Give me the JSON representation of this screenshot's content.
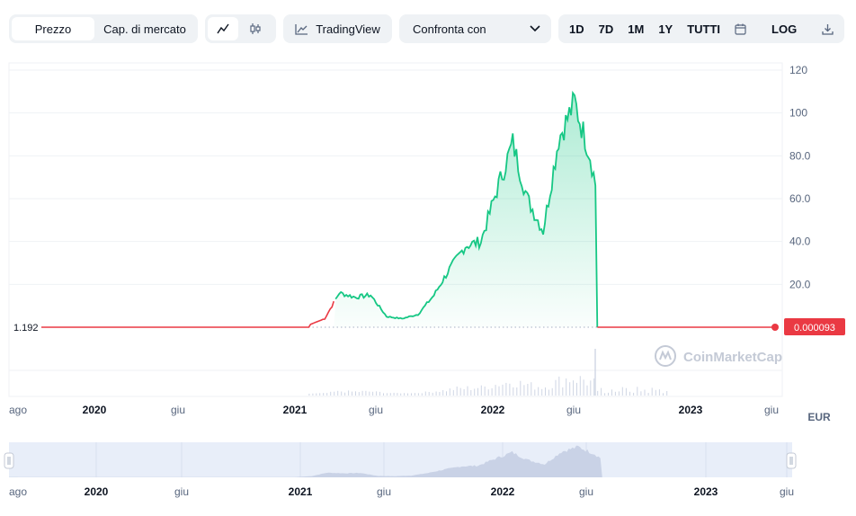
{
  "toolbar": {
    "price_tab": "Prezzo",
    "market_cap_tab": "Cap. di mercato",
    "tradingview_label": "TradingView",
    "compare_label": "Confronta con",
    "ranges": [
      "1D",
      "7D",
      "1M",
      "1Y",
      "TUTTI"
    ],
    "log_label": "LOG"
  },
  "watermark": "CoinMarketCap",
  "currency": "EUR",
  "start_label": "1.192",
  "current_price_label": "0.000093",
  "colors": {
    "up": "#16c784",
    "down": "#ea3943",
    "current_badge": "#ea3943"
  },
  "chart_data": {
    "type": "line",
    "y_axis": {
      "ticks": [
        "120",
        "100",
        "80.0",
        "60.0",
        "40.0",
        "20.0"
      ],
      "ylim": [
        0,
        120
      ]
    },
    "x_tick_labels": [
      "ago",
      "2020",
      "giu",
      "2021",
      "giu",
      "2022",
      "giu",
      "2023",
      "giu"
    ],
    "navigator_tick_labels": [
      "ago",
      "2020",
      "giu",
      "2021",
      "giu",
      "2022",
      "giu",
      "2023",
      "giu"
    ],
    "baseline": 1.192,
    "series": [
      {
        "x": [
          "2019-08",
          "2019-10",
          "2019-12",
          "2020-02",
          "2020-04",
          "2020-06",
          "2020-08",
          "2020-10",
          "2020-12",
          "2021-01",
          "2021-02",
          "2021-03",
          "2021-04",
          "2021-05",
          "2021-06",
          "2021-07",
          "2021-08",
          "2021-09",
          "2021-10",
          "2021-11",
          "2021-12",
          "2022-01",
          "2022-02",
          "2022-03",
          "2022-04",
          "2022-05",
          "2022-06",
          "2022-07",
          "2022-09",
          "2022-11",
          "2023-01",
          "2023-03",
          "2023-05",
          "2023-06"
        ],
        "y": [
          1.192,
          0.8,
          0.6,
          0.5,
          0.5,
          0.6,
          0.7,
          0.8,
          0.9,
          1.0,
          4,
          16,
          14,
          15,
          5,
          4,
          6,
          15,
          27,
          38,
          40,
          64,
          86,
          60,
          45,
          88,
          105,
          80,
          0.0001,
          0.0001,
          0.0001,
          0.0001,
          0.0001,
          9.3e-05
        ]
      }
    ]
  }
}
